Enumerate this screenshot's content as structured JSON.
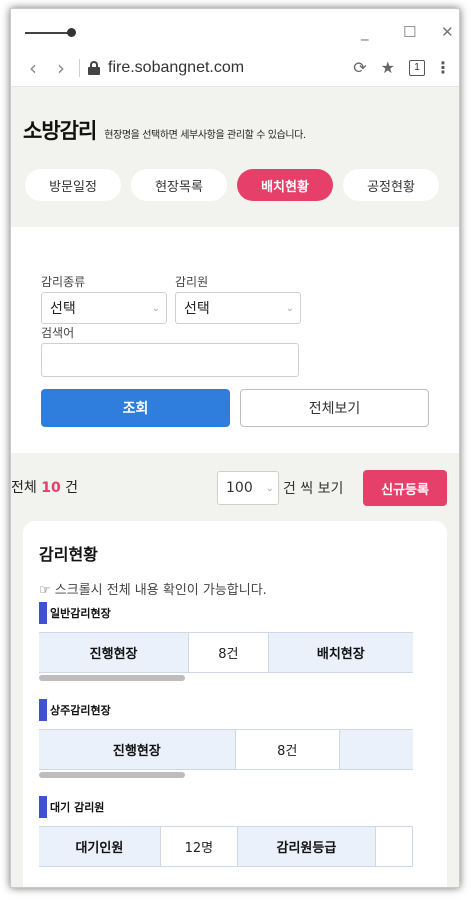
{
  "browser": {
    "url": "fire.sobangnet.com",
    "tab_count": "1"
  },
  "hero": {
    "title": "소방감리",
    "description": "현장명을 선택하면 세부사항을 관리할 수 있습니다."
  },
  "tabs": [
    {
      "label": "방문일정",
      "active": false
    },
    {
      "label": "현장목록",
      "active": false
    },
    {
      "label": "배치현황",
      "active": true
    },
    {
      "label": "공정현황",
      "active": false
    }
  ],
  "filter": {
    "type_label": "감리종류",
    "type_value": "선택",
    "inspector_label": "감리원",
    "inspector_value": "선택",
    "keyword_label": "검색어",
    "keyword_value": "",
    "search_button": "조회",
    "view_all_button": "전체보기"
  },
  "list": {
    "total_prefix": "전체",
    "total_count": "10",
    "total_suffix": "건",
    "per_page": "100",
    "per_page_suffix": "건 씩 보기",
    "new_button": "신규등록"
  },
  "status": {
    "title": "감리현황",
    "scroll_hint": "☞ 스크롤시 전체 내용 확인이 가능합니다.",
    "sections": [
      {
        "name": "일반감리현장",
        "cells": [
          "진행현장",
          "8건",
          "배치현장"
        ]
      },
      {
        "name": "상주감리현장",
        "cells": [
          "진행현장",
          "8건"
        ]
      },
      {
        "name": "대기 감리원",
        "cells": [
          "대기인원",
          "12명",
          "감리원등급"
        ]
      }
    ]
  },
  "colors": {
    "accent_pink": "#e6406a",
    "primary_blue": "#2f7ddc",
    "section_bar": "#3f51d4"
  }
}
